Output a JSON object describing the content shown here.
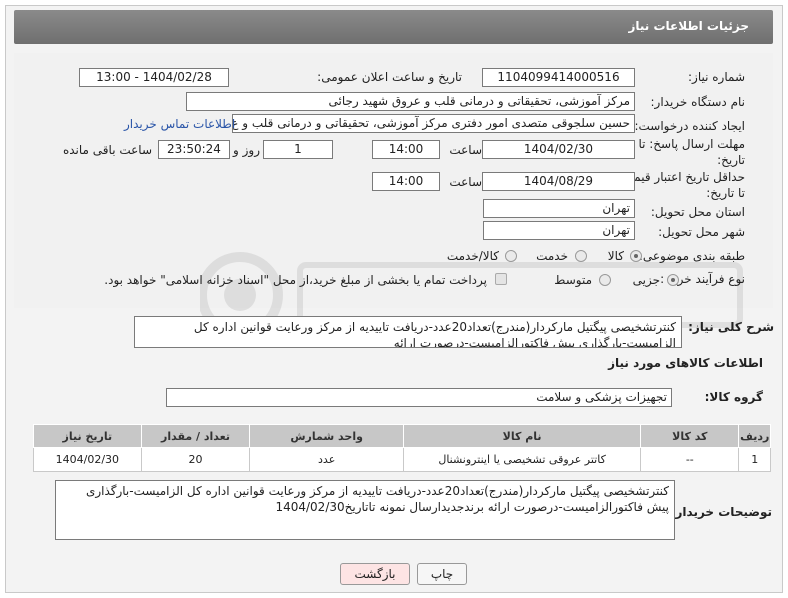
{
  "header": {
    "title": "جزئیات اطلاعات نیاز"
  },
  "fields": {
    "need_number_label": "شماره نیاز:",
    "need_number": "1104099414000516",
    "announce_label": "تاریخ و ساعت اعلان عمومی:",
    "announce_value": "1404/02/28 - 13:00",
    "buyer_org_label": "نام دستگاه خریدار:",
    "buyer_org": "مرکز آموزشی، تحقیقاتی و درمانی قلب و عروق شهید رجائی",
    "creator_label": "ایجاد کننده درخواست:",
    "creator": "حسین سلجوقی متصدی امور دفتری مرکز آموزشی، تحقیقاتی و درمانی قلب و ع",
    "contact_link": "اطلاعات تماس خریدار",
    "reply_deadline_label_1": "مهلت ارسال پاسخ: تا",
    "reply_deadline_label_2": "تاریخ:",
    "reply_date": "1404/02/30",
    "time_label": "ساعت",
    "reply_time": "14:00",
    "day_count": "1",
    "day_label": "روز و",
    "remaining_time": "23:50:24",
    "remaining_label": "ساعت باقی مانده",
    "price_validity_label_1": "حداقل تاریخ اعتبار قیمت:",
    "price_validity_label_2": "تا تاریخ:",
    "price_date": "1404/08/29",
    "price_time": "14:00",
    "province_label": "استان محل تحویل:",
    "province": "تهران",
    "city_label": "شهر محل تحویل:",
    "city": "تهران",
    "category_label": "طبقه بندی موضوعی:",
    "category_options": [
      "کالا",
      "خدمت",
      "کالا/خدمت"
    ],
    "process_label": "نوع فرآیند خرید :",
    "process_options": [
      "جزیی",
      "متوسط"
    ],
    "payment_note": "پرداخت تمام یا بخشی از مبلغ خرید،از محل \"اسناد خزانه اسلامی\" خواهد بود."
  },
  "summary": {
    "label": "شرح کلی نیاز:",
    "text": "کنترتشخیصی پیگتیل مارکردار(مندرج)تعداد20عدد-دریافت تاییدیه از مرکز ورعایت قوانین اداره کل الزامیست-بارگذاری پیش فاکتورالزامیست-درصورت ارائه"
  },
  "goods": {
    "section_title": "اطلاعات کالاهای مورد نیاز",
    "group_label": "گروه کالا:",
    "group_value": "تجهیزات پزشکی و سلامت",
    "columns": [
      "ردیف",
      "کد کالا",
      "نام کالا",
      "واحد شمارش",
      "تعداد / مقدار",
      "تاریخ نیاز"
    ],
    "rows": [
      [
        "1",
        "--",
        "کاتتر عروقی تشخیصی یا اینترونشنال",
        "عدد",
        "20",
        "1404/02/30"
      ]
    ]
  },
  "buyer_notes": {
    "label": "توضیحات خریدار:",
    "text": "کنترتشخیصی پیگتیل مارکردار(مندرج)تعداد20عدد-دریافت تاییدیه از مرکز ورعایت قوانین اداره کل الزامیست-بارگذاری پیش فاکتورالزامیست-درصورت ارائه برندجدیدارسال نمونه تاتاریخ1404/02/30"
  },
  "buttons": {
    "print": "چاپ",
    "back": "بازگشت"
  },
  "colors": {
    "header": "#7a7a7a",
    "link": "#2a55a8",
    "back_button": "#fde4e4"
  }
}
